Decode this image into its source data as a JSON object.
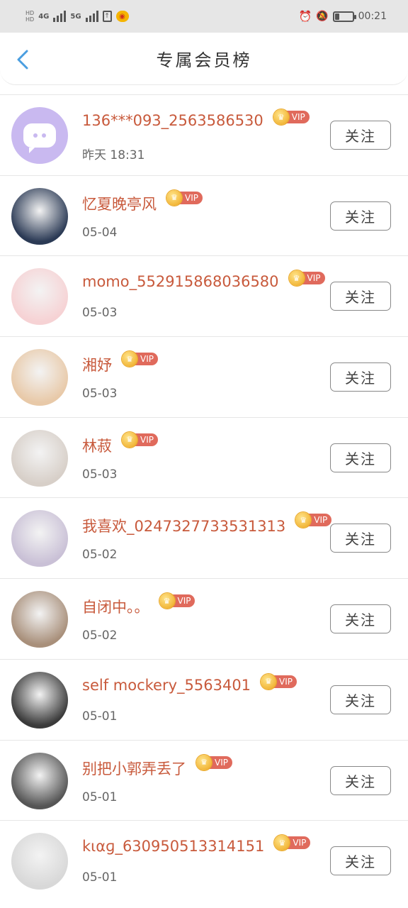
{
  "status_bar": {
    "net_hd1": "HD",
    "net_hd2": "HD",
    "net1": "4G",
    "net2": "5G",
    "time": "00:21",
    "battery_level": 0.25,
    "icons": [
      "hd-icon",
      "signal-icon",
      "upload-icon",
      "weibo-icon",
      "alarm-icon",
      "mute-icon",
      "battery-icon"
    ]
  },
  "header": {
    "title": "专属会员榜",
    "back_icon": "chevron-left-icon",
    "accent": "#4a9ee0"
  },
  "vip_label": "VIP",
  "follow_label": "关注",
  "members": [
    {
      "name": "136***093_2563586530",
      "time": "昨天  18:31",
      "avatar": "default-avatar"
    },
    {
      "name": "忆夏晚亭风",
      "time": "05-04",
      "avatar": "avatar-photo"
    },
    {
      "name": "momo_552915868036580",
      "time": "05-03",
      "avatar": "avatar-photo"
    },
    {
      "name": "湘妤",
      "time": "05-03",
      "avatar": "avatar-photo"
    },
    {
      "name": "林菽",
      "time": "05-03",
      "avatar": "avatar-photo"
    },
    {
      "name": "我喜欢_0247327733531313",
      "time": "05-02",
      "avatar": "avatar-photo"
    },
    {
      "name": "自闭中。。",
      "time": "05-02",
      "avatar": "avatar-photo"
    },
    {
      "name": "self mockery_5563401",
      "time": "05-01",
      "avatar": "avatar-photo"
    },
    {
      "name": "别把小郭弄丢了",
      "time": "05-01",
      "avatar": "avatar-photo"
    },
    {
      "name": "kιαɡ_630950513314151",
      "time": "05-01",
      "avatar": "avatar-photo"
    }
  ],
  "colors": {
    "name": "#c85a3c",
    "vip": "#e06a5c",
    "crown": "#f2b73a"
  }
}
